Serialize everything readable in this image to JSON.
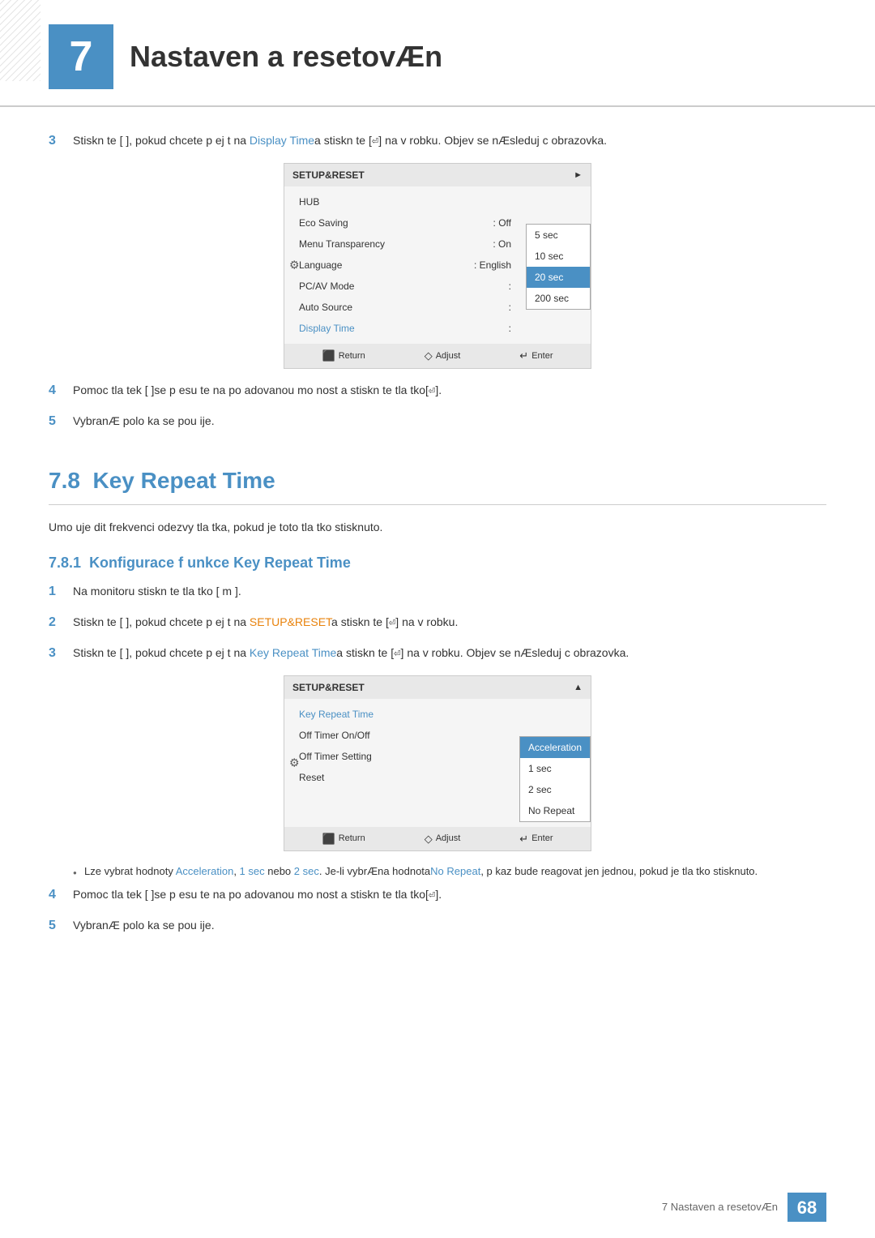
{
  "chapter": {
    "number": "7",
    "title": "Nastaven  a resetovÆn"
  },
  "section3_intro": {
    "step3_text": "Stiskn te [     ], pokud chcete p ej t na ",
    "step3_highlight": "Display Time",
    "step3_suffix": "a stiskn te [",
    "step3_icon": "⏎",
    "step3_end": "] na v robku. Objev  se nÆsleduj c  obrazovka.",
    "step4_text": "Pomoc  tla  tek [     ]se p esu te na po adovanou mo nost a stiskn te tla  tko[",
    "step4_end": "].",
    "step5_text": "VybranÆ polo ka se pou ije."
  },
  "menu1": {
    "title": "SETUP&RESET",
    "items": [
      {
        "label": "HUB",
        "value": ""
      },
      {
        "label": "Eco Saving",
        "value": "Off"
      },
      {
        "label": "Menu Transparency",
        "value": "On"
      },
      {
        "label": "Language",
        "value": "English"
      },
      {
        "label": "PC/AV Mode",
        "value": ""
      },
      {
        "label": "Auto Source",
        "value": ""
      },
      {
        "label": "Display Time",
        "value": ""
      }
    ],
    "submenu": [
      {
        "label": "5 sec",
        "active": false
      },
      {
        "label": "10 sec",
        "active": false
      },
      {
        "label": "20 sec",
        "active": true
      },
      {
        "label": "200 sec",
        "active": false
      }
    ],
    "footer": {
      "return": "Return",
      "adjust": "Adjust",
      "enter": "Enter"
    }
  },
  "section78": {
    "number": "7.8",
    "title": "Key Repeat Time",
    "description": "Umo  uje  dit frekvenci odezvy tla  tka, pokud je toto tla  tko stisknuto.",
    "subsection": {
      "number": "7.8.1",
      "title": "Konfigurace f unkce Key Repeat Time"
    },
    "steps": {
      "step1": "Na monitoru stiskn te tla  tko [ m ].",
      "step2_pre": "Stiskn te [     ], pokud chcete p ej t na ",
      "step2_highlight": "SETUP&RESET",
      "step2_suffix": "a stiskn te [",
      "step2_icon": "⏎",
      "step2_end": "] na v robku.",
      "step3_pre": "Stiskn te [     ], pokud chcete p ej t na ",
      "step3_highlight": "Key Repeat Time",
      "step3_suffix": "a stiskn te [",
      "step3_icon": "⏎",
      "step3_end": "] na v robku. Objev  se nÆsleduj c  obrazovka.",
      "step4": "Pomoc  tla  tek [     ]se p esu te na po adovanou mo nost a stiskn te tla  tko[",
      "step4_end": "].",
      "step5": "VybranÆ polo ka se pou ije."
    },
    "bullet": {
      "pre": "Lze vybrat hodnoty",
      "val1": "Acceleration",
      "sep1": ", ",
      "val2": "1 sec",
      "mid": " nebo ",
      "val3": "2 sec",
      "mid2": ". Je-li vybrÆna hodnota",
      "val4": "No Repeat",
      "end": ", p  kaz bude reagovat jen jednou, pokud je tla  tko stisknuto."
    }
  },
  "menu2": {
    "title": "SETUP&RESET",
    "items": [
      {
        "label": "Key Repeat Time",
        "value": "",
        "isHighlight": true
      },
      {
        "label": "Off Timer On/Off",
        "value": ""
      },
      {
        "label": "Off Timer Setting",
        "value": ""
      },
      {
        "label": "Reset",
        "value": ""
      }
    ],
    "submenu": [
      {
        "label": "Acceleration",
        "active": true
      },
      {
        "label": "1 sec",
        "active": false
      },
      {
        "label": "2 sec",
        "active": false
      },
      {
        "label": "No Repeat",
        "active": false
      }
    ],
    "footer": {
      "return": "Return",
      "adjust": "Adjust",
      "enter": "Enter"
    }
  },
  "footer": {
    "text": "7 Nastaven  a resetovÆn",
    "page": "68"
  }
}
